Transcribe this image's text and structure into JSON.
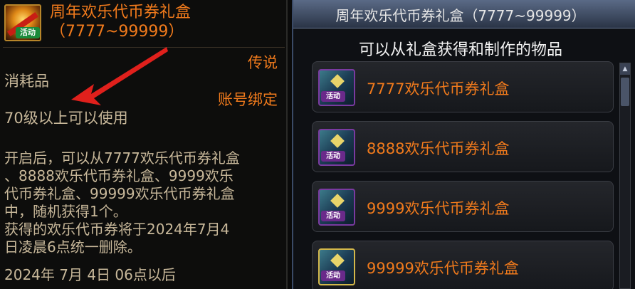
{
  "tooltip": {
    "item_name": "周年欢乐代币券礼盒（7777~99999）",
    "badge": "活动",
    "rarity": "传说",
    "category": "消耗品",
    "binding": "账号绑定",
    "level_requirement": "70级以上可以使用",
    "description_lines": [
      "开启后，可以从7777欢乐代币券礼盒",
      "、8888欢乐代币券礼盒、9999欢乐",
      "代币券礼盒、99999欢乐代币券礼盒",
      "中，随机获得1个。",
      "获得的欢乐代币券将于2024年7月4",
      "日凌晨6点统一删除。",
      "",
      "2024年 7月 4日 06点以后"
    ],
    "arrow_color": "#e0201c"
  },
  "window": {
    "title": "周年欢乐代币券礼盒（7777~99999）",
    "subtitle": "可以从礼盒获得和制作的物品",
    "items": [
      {
        "label": "7777欢乐代币券礼盒",
        "badge": "活动",
        "icon": "gift-box-icon"
      },
      {
        "label": "8888欢乐代币券礼盒",
        "badge": "活动",
        "icon": "gift-box-icon"
      },
      {
        "label": "9999欢乐代币券礼盒",
        "badge": "活动",
        "icon": "gift-box-icon"
      },
      {
        "label": "99999欢乐代币券礼盒",
        "badge": "活动",
        "icon": "gift-box-icon"
      }
    ],
    "scroll_up_icon": "▲"
  },
  "colors": {
    "accent_orange": "#f07a1c",
    "body_text": "#c8b89a",
    "title_bar": "#5a6a86"
  }
}
